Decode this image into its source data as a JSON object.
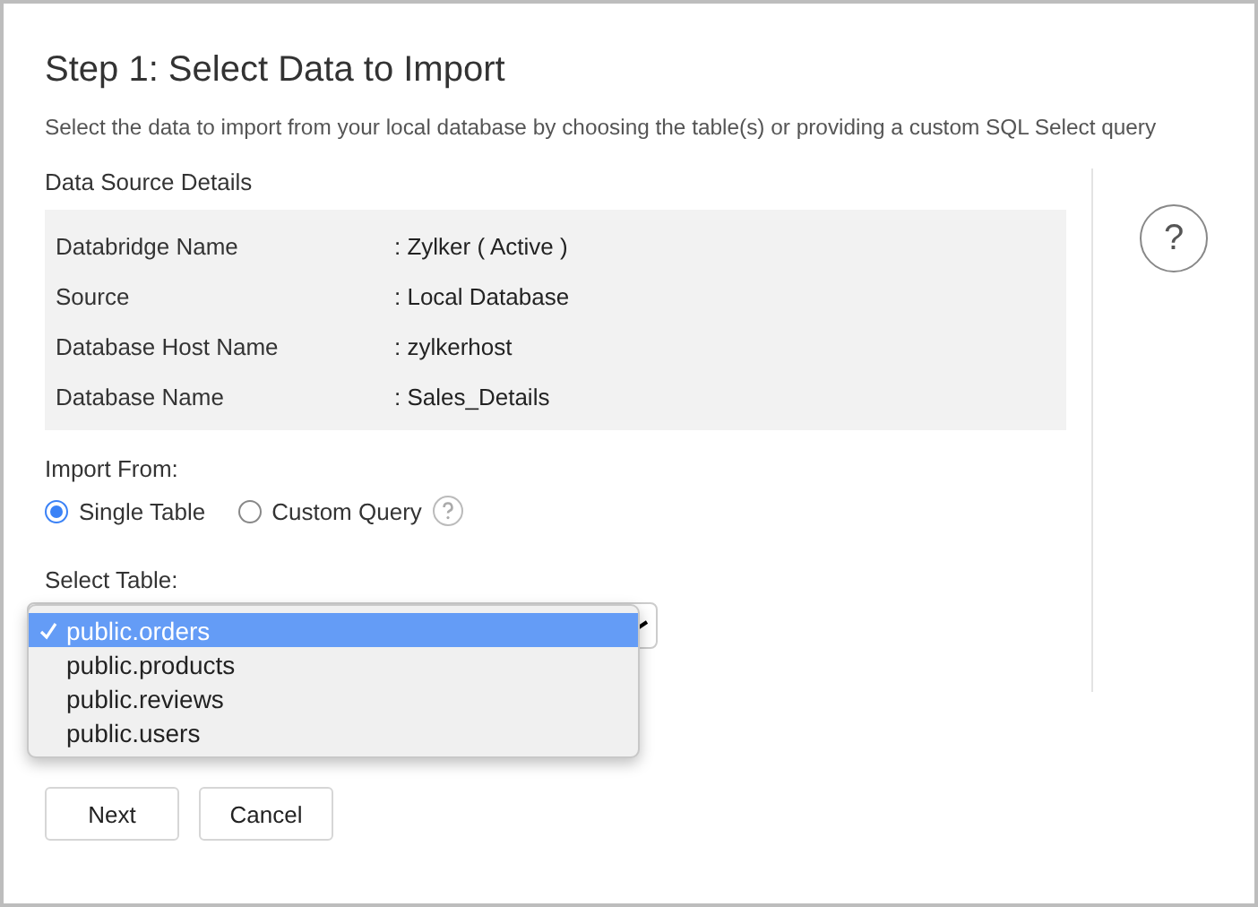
{
  "title": "Step 1: Select Data to Import",
  "subtitle": "Select the data to import from your local database by choosing the table(s) or providing a custom SQL Select query",
  "details": {
    "heading": "Data Source Details",
    "rows": [
      {
        "label": "Databridge Name",
        "value": ": Zylker ( Active )"
      },
      {
        "label": "Source",
        "value": ": Local Database"
      },
      {
        "label": "Database Host Name",
        "value": ": zylkerhost"
      },
      {
        "label": "Database Name",
        "value": ": Sales_Details"
      }
    ]
  },
  "import_from": {
    "label": "Import From:",
    "options": [
      {
        "label": "Single Table",
        "selected": true,
        "help": false
      },
      {
        "label": "Custom Query",
        "selected": false,
        "help": true
      }
    ]
  },
  "select_table": {
    "label": "Select Table:",
    "options": [
      {
        "label": "public.orders",
        "selected": true
      },
      {
        "label": "public.products",
        "selected": false
      },
      {
        "label": "public.reviews",
        "selected": false
      },
      {
        "label": "public.users",
        "selected": false
      }
    ]
  },
  "help_button": "?",
  "buttons": [
    "Next",
    "Cancel"
  ]
}
